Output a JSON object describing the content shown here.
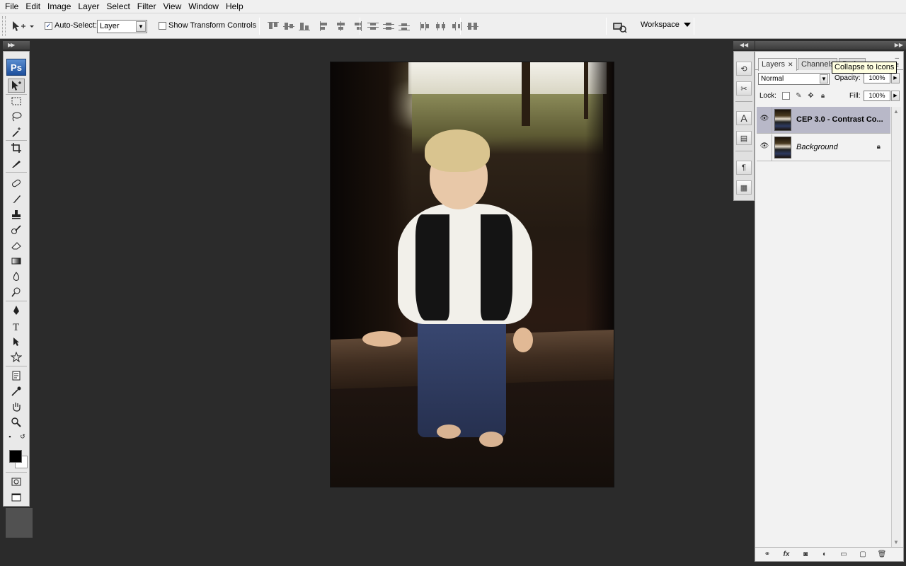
{
  "menu": [
    "File",
    "Edit",
    "Image",
    "Layer",
    "Select",
    "Filter",
    "View",
    "Window",
    "Help"
  ],
  "options": {
    "auto_select_label": "Auto-Select:",
    "auto_select_checked": true,
    "auto_select_value": "Layer",
    "transform_label": "Show Transform Controls",
    "transform_checked": false,
    "workspace_label": "Workspace"
  },
  "toolbox": {
    "logo": "Ps",
    "tools": [
      "move-tool-icon",
      "marquee-tool-icon",
      "lasso-tool-icon",
      "magic-wand-tool-icon",
      "crop-tool-icon",
      "slice-tool-icon",
      "spot-healing-tool-icon",
      "brush-tool-icon",
      "clone-stamp-tool-icon",
      "history-brush-tool-icon",
      "eraser-tool-icon",
      "gradient-tool-icon",
      "blur-tool-icon",
      "dodge-tool-icon",
      "pen-tool-icon",
      "type-tool-icon",
      "path-selection-tool-icon",
      "shape-tool-icon",
      "notes-tool-icon",
      "eyedropper-tool-icon",
      "hand-tool-icon",
      "zoom-tool-icon"
    ],
    "foreground_color": "#000000",
    "background_color": "#ffffff"
  },
  "panel": {
    "tabs": [
      "Layers",
      "Channels",
      "Paths"
    ],
    "active_tab": "Layers",
    "tooltip": "Collapse to Icons",
    "blend_mode": "Normal",
    "opacity_label": "Opacity:",
    "opacity_value": "100%",
    "lock_label": "Lock:",
    "fill_label": "Fill:",
    "fill_value": "100%",
    "layers": [
      {
        "name": "CEP 3.0 - Contrast Co...",
        "visible": true,
        "active": true,
        "locked": false
      },
      {
        "name": "Background",
        "visible": true,
        "active": false,
        "locked": true
      }
    ]
  },
  "colors": {
    "canvas_bg": "#2b2b2b",
    "active_layer": "#b8b8c8",
    "ps_logo": "#2f65b4"
  }
}
